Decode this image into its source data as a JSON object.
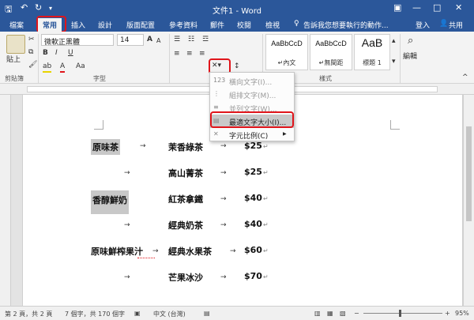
{
  "app": {
    "title": "文件1 - Word",
    "colors": {
      "brand": "#2b579a",
      "highlight_red": "#e0151b",
      "selection": "#c8c8c8"
    }
  },
  "quick_access": {
    "save_icon": "save-icon",
    "undo_icon": "undo-icon",
    "redo_icon": "redo-icon",
    "customize_icon": "customize-icon"
  },
  "window_controls": {
    "ribbon_options": "▣",
    "minimize": "—",
    "maximize": "□",
    "close": "✕"
  },
  "tabs": [
    {
      "label": "檔案"
    },
    {
      "label": "常用"
    },
    {
      "label": "插入"
    },
    {
      "label": "設計"
    },
    {
      "label": "版面配置"
    },
    {
      "label": "參考資料"
    },
    {
      "label": "郵件"
    },
    {
      "label": "校閱"
    },
    {
      "label": "檢視"
    }
  ],
  "tell_me": "告訴我您想要執行的動作...",
  "account": {
    "signin": "登入",
    "share": "共用"
  },
  "ribbon": {
    "clipboard": {
      "paste_label": "貼上",
      "group_label": "剪貼簿"
    },
    "font": {
      "font_name": "微軟正黑體",
      "font_size": "14",
      "group_label": "字型",
      "bold": "B",
      "italic": "I",
      "underline": "U",
      "font_color": "A",
      "highlight": "ab",
      "size_up": "A",
      "size_down": "A",
      "clear": "Aa"
    },
    "paragraph": {
      "group_label": "段"
    },
    "styles": {
      "group_label": "樣式",
      "items": [
        {
          "sample": "AaBbCcD",
          "name": "↵內文"
        },
        {
          "sample": "AaBbCcD",
          "name": "↵無間距"
        },
        {
          "sample": "AaB",
          "name": "標題 1"
        }
      ]
    },
    "editing": {
      "label": "編輯"
    }
  },
  "menu": {
    "items": [
      {
        "icon": "123",
        "label": "橫向文字(I)...",
        "enabled": false
      },
      {
        "icon": "⋮",
        "label": "組排文字(M)...",
        "enabled": false
      },
      {
        "icon": "≡",
        "label": "並列文字(W)...",
        "enabled": false
      },
      {
        "icon": "▤",
        "label": "最適文字大小(I)...",
        "enabled": true
      },
      {
        "icon": "✕",
        "label": "字元比例(C)",
        "enabled": true,
        "submenu": "▶"
      }
    ]
  },
  "document": {
    "arrow": "→",
    "pilcrow": "↵",
    "rows": [
      {
        "col1": "原味茶",
        "col2": "茉香綠茶",
        "price": "$25"
      },
      {
        "col1": "",
        "col2": "高山菁茶",
        "price": "$25"
      },
      {
        "col1": "香醇鮮奶",
        "col2": "紅茶拿鐵",
        "price": "$40"
      },
      {
        "col1": "",
        "col2": "經典奶茶",
        "price": "$40"
      },
      {
        "col1": "原味鮮榨果汁",
        "col2": "經典水果茶",
        "price": "$60"
      },
      {
        "col1": "",
        "col2": "芒果冰沙",
        "price": "$70"
      }
    ]
  },
  "status": {
    "page": "第 2 頁，共 2 頁",
    "words": "7 個字，共 170 個字",
    "language": "中文 (台灣)",
    "zoom": "95%"
  }
}
